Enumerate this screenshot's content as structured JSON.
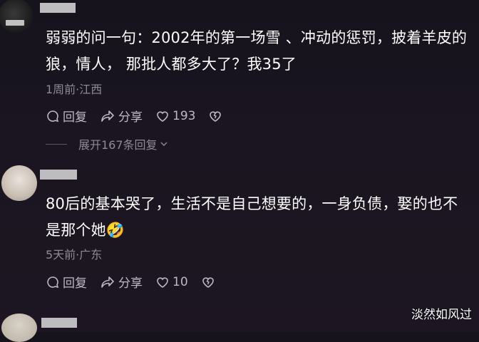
{
  "comments": [
    {
      "text_line1": "弱弱的问一句：2002年的第一场雪 、冲动的惩罚，披着羊皮的",
      "text_line2": "狼，情人， 那批人都多大了？我35了",
      "meta": "1周前·江西",
      "reply_label": "回复",
      "share_label": "分享",
      "like_count": "193",
      "expand_label": "展开167条回复"
    },
    {
      "text_line1": "80后的基本哭了，生活不是自己想要的，一身负债，娶的也不",
      "text_line2": "是那个她",
      "emoji": "🤣",
      "meta": "5天前·广东",
      "reply_label": "回复",
      "share_label": "分享",
      "like_count": "10"
    }
  ],
  "watermark": "淡然如风过",
  "colors": {
    "background": "#1a1520",
    "text": "#ffffff",
    "meta": "#8e8a93",
    "action": "#bdb9c2"
  }
}
